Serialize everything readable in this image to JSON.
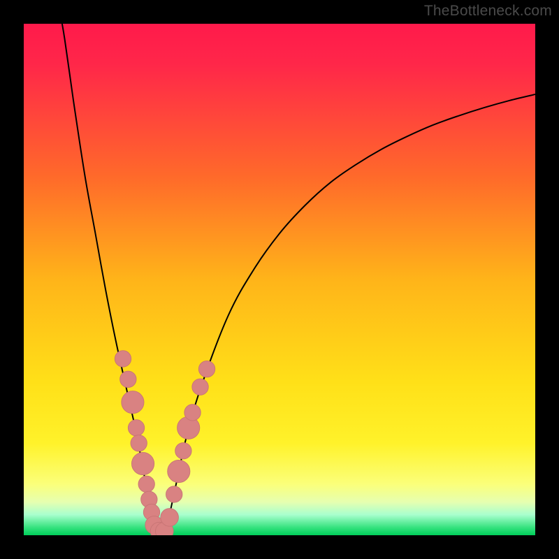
{
  "watermark": "TheBottleneck.com",
  "colors": {
    "frame": "#000000",
    "gradient_stops": [
      {
        "offset": 0.0,
        "color": "#ff1a4b"
      },
      {
        "offset": 0.08,
        "color": "#ff2749"
      },
      {
        "offset": 0.3,
        "color": "#ff6a2a"
      },
      {
        "offset": 0.5,
        "color": "#ffb419"
      },
      {
        "offset": 0.7,
        "color": "#ffe018"
      },
      {
        "offset": 0.82,
        "color": "#fff22a"
      },
      {
        "offset": 0.9,
        "color": "#fbff7a"
      },
      {
        "offset": 0.935,
        "color": "#e6ffb0"
      },
      {
        "offset": 0.96,
        "color": "#a8ffce"
      },
      {
        "offset": 0.985,
        "color": "#35e27e"
      },
      {
        "offset": 1.0,
        "color": "#00cf5a"
      }
    ],
    "curve": "#000000",
    "marker_fill": "#d98282",
    "marker_stroke": "#c77474"
  },
  "chart_data": {
    "type": "line",
    "title": "",
    "xlabel": "",
    "ylabel": "",
    "xlim": [
      0,
      100
    ],
    "ylim": [
      0,
      100
    ],
    "series": [
      {
        "name": "left-curve",
        "x": [
          7.5,
          8,
          9,
          10,
          12,
          14,
          16,
          18,
          20,
          22,
          23.5,
          24.5,
          25.2,
          25.7
        ],
        "y": [
          100,
          97,
          90,
          83,
          70,
          59,
          48,
          38,
          29,
          20,
          12,
          7,
          3,
          0.5
        ]
      },
      {
        "name": "right-curve",
        "x": [
          27.8,
          28.5,
          30,
          32,
          35,
          40,
          45,
          50,
          55,
          60,
          65,
          70,
          75,
          80,
          85,
          90,
          95,
          100
        ],
        "y": [
          0.5,
          4,
          11,
          20,
          30,
          43,
          52,
          59,
          64.5,
          69,
          72.5,
          75.5,
          78,
          80.2,
          82,
          83.6,
          85,
          86.2
        ]
      }
    ],
    "markers": [
      {
        "x": 20.4,
        "y": 30.5,
        "r": 1.6
      },
      {
        "x": 19.4,
        "y": 34.5,
        "r": 1.6
      },
      {
        "x": 21.3,
        "y": 26.0,
        "r": 2.2
      },
      {
        "x": 22.0,
        "y": 21.0,
        "r": 1.6
      },
      {
        "x": 22.5,
        "y": 18.0,
        "r": 1.6
      },
      {
        "x": 23.3,
        "y": 14.0,
        "r": 2.2
      },
      {
        "x": 24.0,
        "y": 10.0,
        "r": 1.6
      },
      {
        "x": 24.5,
        "y": 7.0,
        "r": 1.6
      },
      {
        "x": 25.0,
        "y": 4.5,
        "r": 1.6
      },
      {
        "x": 25.5,
        "y": 2.0,
        "r": 1.75
      },
      {
        "x": 26.5,
        "y": 0.8,
        "r": 1.75
      },
      {
        "x": 27.5,
        "y": 0.8,
        "r": 1.75
      },
      {
        "x": 28.5,
        "y": 3.5,
        "r": 1.75
      },
      {
        "x": 29.4,
        "y": 8.0,
        "r": 1.6
      },
      {
        "x": 30.3,
        "y": 12.5,
        "r": 2.2
      },
      {
        "x": 31.2,
        "y": 16.5,
        "r": 1.6
      },
      {
        "x": 32.2,
        "y": 21.0,
        "r": 2.2
      },
      {
        "x": 33.0,
        "y": 24.0,
        "r": 1.6
      },
      {
        "x": 34.5,
        "y": 29.0,
        "r": 1.6
      },
      {
        "x": 35.8,
        "y": 32.5,
        "r": 1.6
      }
    ]
  }
}
